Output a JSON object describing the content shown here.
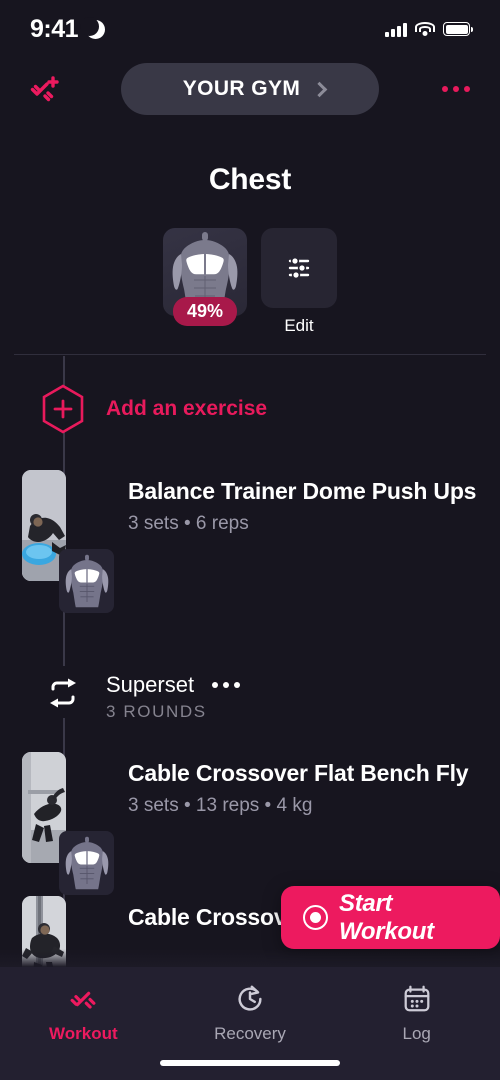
{
  "status_bar": {
    "time": "9:41",
    "moon_icon": "crescent-moon-icon",
    "signal_icon": "cellular-signal-icon",
    "wifi_icon": "wifi-icon",
    "battery_icon": "battery-icon"
  },
  "top_bar": {
    "add_workout_icon": "dumbbell-plus-icon",
    "gym_label": "YOUR GYM",
    "gym_chevron_icon": "chevron-right-icon",
    "more_icon": "more-horizontal-icon"
  },
  "header": {
    "title": "Chest",
    "muscle_percent": "49%",
    "muscle_icon": "torso-muscle-icon",
    "edit_icon": "sliders-icon",
    "edit_label": "Edit"
  },
  "add_exercise": {
    "icon": "hexagon-plus-icon",
    "label": "Add an exercise"
  },
  "exercises": [
    {
      "name": "Balance Trainer Dome Push Ups",
      "meta": "3 sets • 6 reps",
      "thumb_icon": "exercise-photo",
      "badge_icon": "torso-muscle-icon"
    },
    {
      "name": "Cable Crossover Flat Bench Fly",
      "meta": "3 sets • 13 reps • 4 kg",
      "thumb_icon": "exercise-photo",
      "badge_icon": "torso-muscle-icon"
    },
    {
      "name": "Cable Crossover Fly",
      "meta": "",
      "thumb_icon": "exercise-photo",
      "badge_icon": "torso-muscle-icon"
    }
  ],
  "superset": {
    "icon": "repeat-icon",
    "title": "Superset",
    "rounds": "3 ROUNDS",
    "more_icon": "more-horizontal-icon"
  },
  "start_workout": {
    "label": "Start Workout",
    "icon": "record-circle-icon"
  },
  "tabs": [
    {
      "label": "Workout",
      "icon": "dumbbell-icon",
      "active": true
    },
    {
      "label": "Recovery",
      "icon": "clock-refresh-icon",
      "active": false
    },
    {
      "label": "Log",
      "icon": "calendar-icon",
      "active": false
    }
  ],
  "colors": {
    "accent": "#ed1a5f",
    "badge": "#a8194a",
    "background": "#17151f",
    "tabbar": "#232030",
    "pill": "#393846",
    "muted_text": "#9a98a8"
  }
}
